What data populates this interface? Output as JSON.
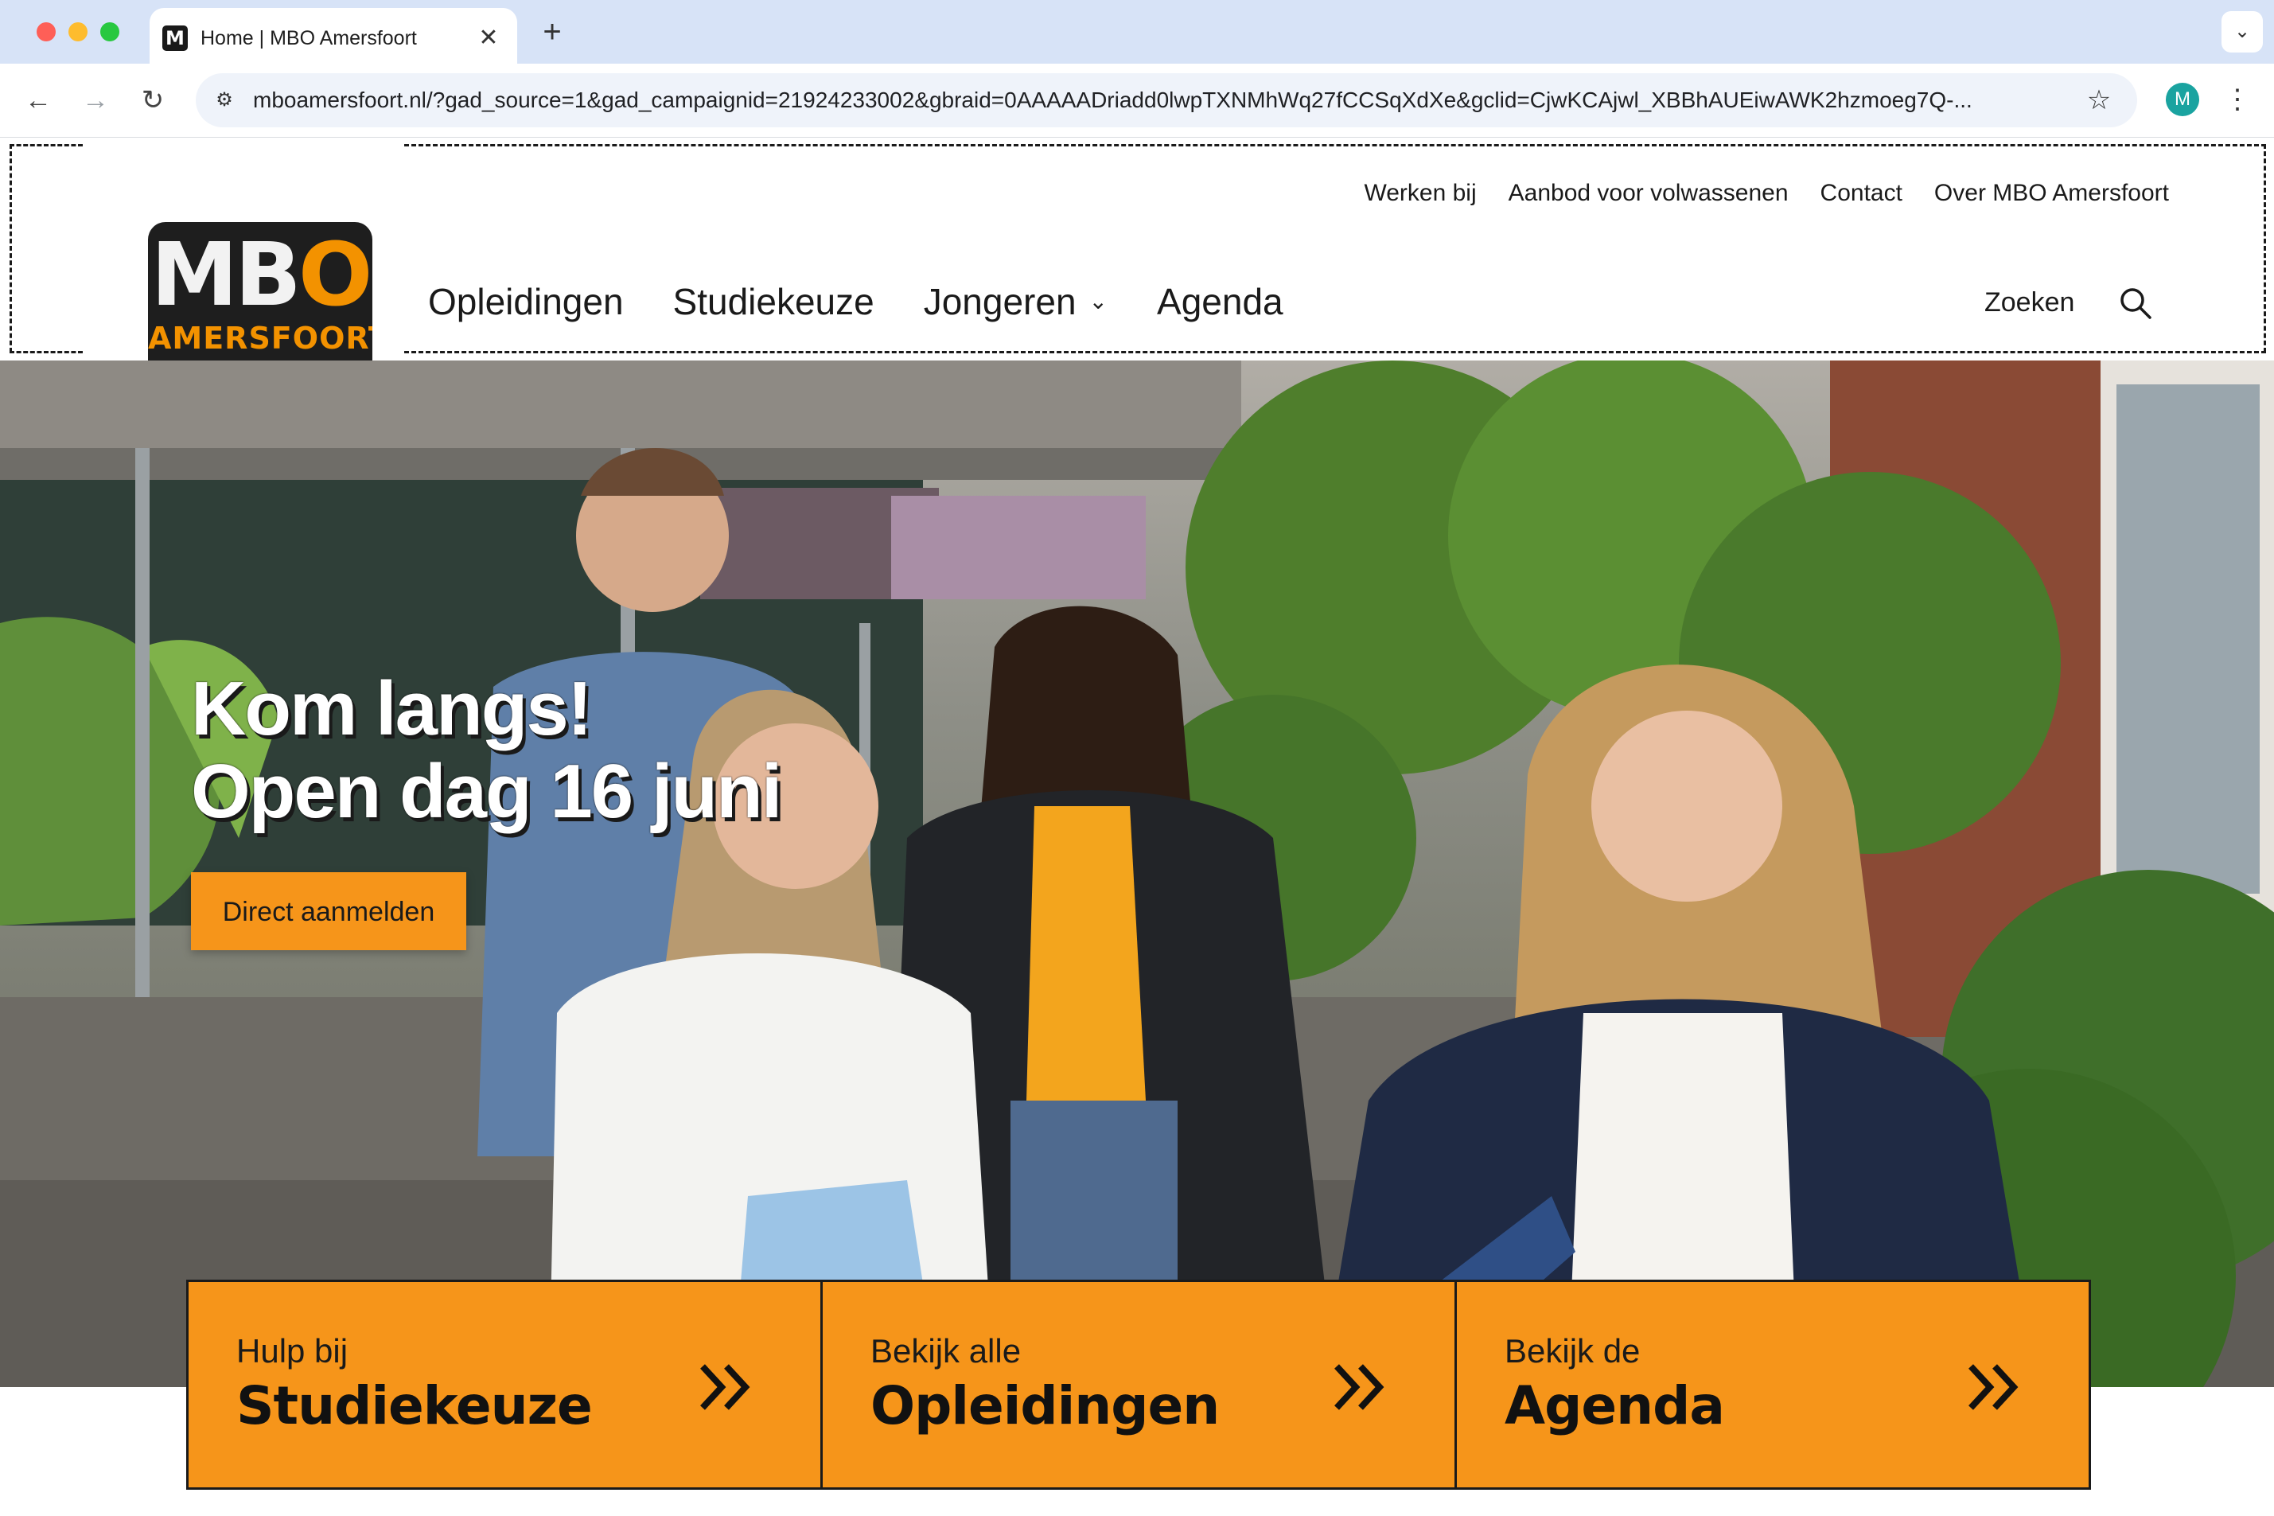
{
  "browser": {
    "tab_title": "Home | MBO Amersfoort",
    "favicon_letter": "M",
    "close_glyph": "✕",
    "new_tab_glyph": "+",
    "tab_menu_glyph": "⌄",
    "back_glyph": "←",
    "forward_glyph": "→",
    "reload_glyph": "↻",
    "site_settings_glyph": "⚙",
    "url": "mboamersfoort.nl/?gad_source=1&gad_campaignid=21924233002&gbraid=0AAAAADriadd0lwpTXNMhWq27fCCSqXdXe&gclid=CjwKCAjwl_XBBhAUEiwAWK2hzmoeg7Q-...",
    "star_glyph": "☆",
    "profile_initial": "M",
    "menu_glyph": "⋮",
    "profile_color": "#1aa3a0"
  },
  "logo": {
    "mbo_text_main": "MB",
    "mbo_text_o": "O",
    "subtitle": "AMERSFOORT"
  },
  "utility_nav": [
    "Werken bij",
    "Aanbod voor volwassenen",
    "Contact",
    "Over MBO Amersfoort"
  ],
  "main_nav": {
    "items": [
      {
        "label": "Opleidingen"
      },
      {
        "label": "Studiekeuze"
      },
      {
        "label": "Jongeren",
        "has_dropdown": true
      },
      {
        "label": "Agenda"
      }
    ],
    "chevron_glyph": "⌄",
    "search_label": "Zoeken",
    "search_icon": "search-icon"
  },
  "hero": {
    "title_line1": "Kom langs!",
    "title_line2": "Open dag 16 juni",
    "cta_label": "Direct aanmelden",
    "image_description_icon": "hero-photo"
  },
  "tiles": [
    {
      "small": "Hulp bij",
      "big": "Studiekeuze",
      "icon": "double-chevron-right-icon"
    },
    {
      "small": "Bekijk alle",
      "big": "Opleidingen",
      "icon": "double-chevron-right-icon"
    },
    {
      "small": "Bekijk de",
      "big": "Agenda",
      "icon": "double-chevron-right-icon"
    }
  ],
  "colors": {
    "accent_orange": "#f6951a",
    "logo_orange": "#f39200",
    "logo_dark": "#1e1e1e",
    "text_dark": "#1a1a1a"
  }
}
